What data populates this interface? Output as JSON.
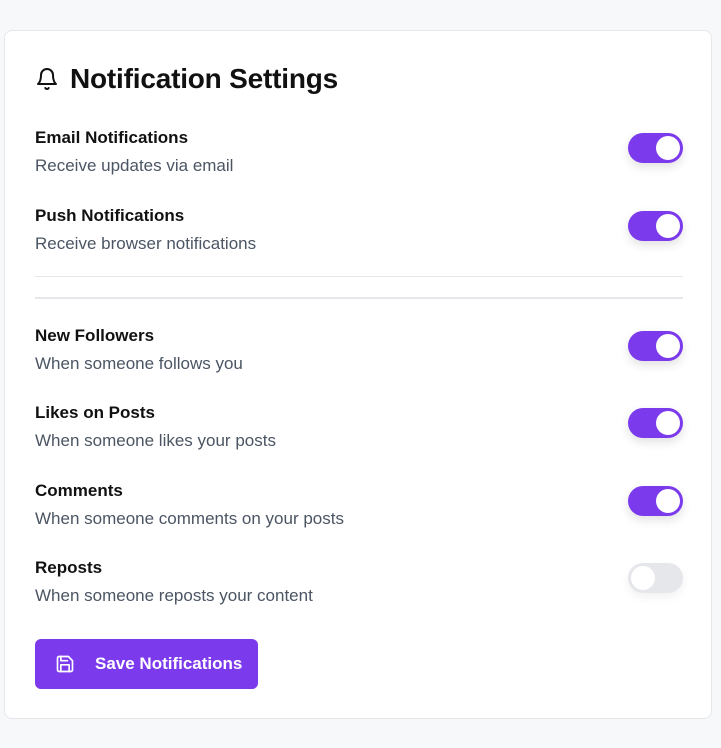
{
  "header": {
    "title": "Notification Settings",
    "icon": "bell-icon"
  },
  "settings": [
    {
      "label": "Email Notifications",
      "description": "Receive updates via email",
      "enabled": true
    },
    {
      "label": "Push Notifications",
      "description": "Receive browser notifications",
      "enabled": true
    },
    {
      "label": "New Followers",
      "description": "When someone follows you",
      "enabled": true
    },
    {
      "label": "Likes on Posts",
      "description": "When someone likes your posts",
      "enabled": true
    },
    {
      "label": "Comments",
      "description": "When someone comments on your posts",
      "enabled": true
    },
    {
      "label": "Reposts",
      "description": "When someone reposts your content",
      "enabled": false
    }
  ],
  "save_button": {
    "label": "Save Notifications",
    "icon": "save-icon"
  },
  "colors": {
    "accent": "#7c3aed",
    "toggle_off": "#e5e7eb",
    "text": "#111111",
    "muted": "#4b5563"
  }
}
